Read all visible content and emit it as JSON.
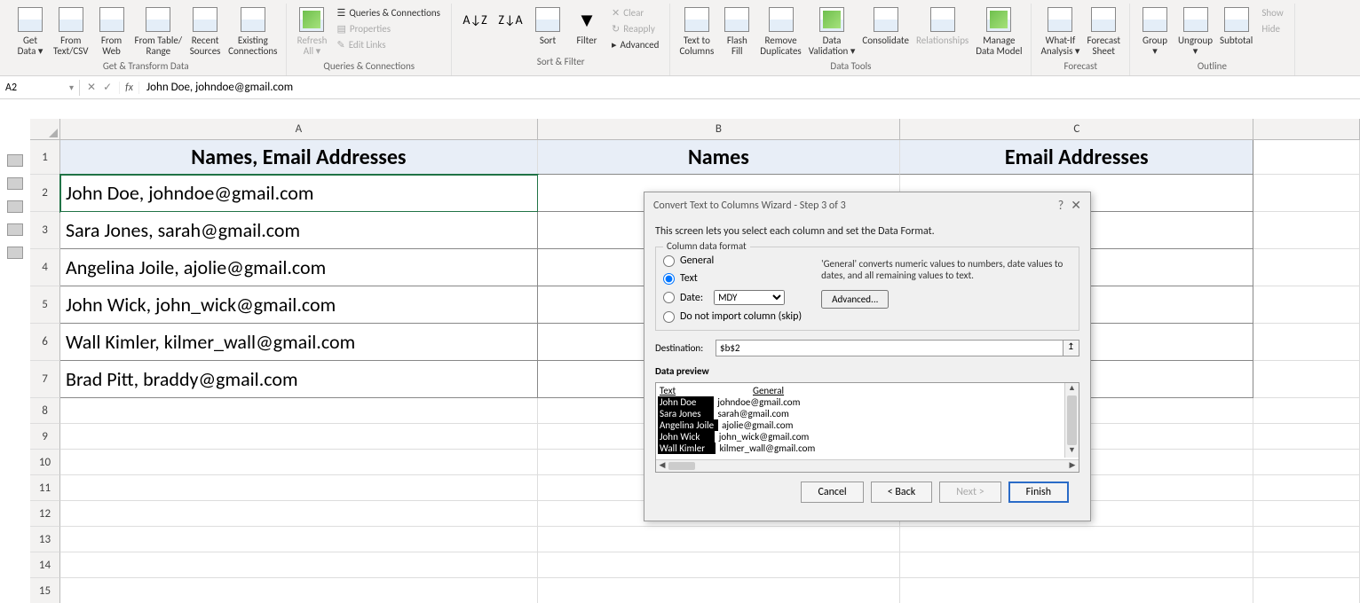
{
  "ribbon": {
    "groups": {
      "get_transform": {
        "label": "Get & Transform Data",
        "buttons": [
          "Get\nData ▾",
          "From\nText/CSV",
          "From\nWeb",
          "From Table/\nRange",
          "Recent\nSources",
          "Existing\nConnections"
        ]
      },
      "queries": {
        "label": "Queries & Connections",
        "buttons": [
          "Refresh\nAll ▾"
        ],
        "small": [
          "Queries & Connections",
          "Properties",
          "Edit Links"
        ]
      },
      "sort_filter": {
        "label": "Sort & Filter",
        "buttons": [
          "Sort",
          "Filter"
        ],
        "small": [
          "Clear",
          "Reapply",
          "Advanced"
        ]
      },
      "data_tools": {
        "label": "Data Tools",
        "buttons": [
          "Text to\nColumns",
          "Flash\nFill",
          "Remove\nDuplicates",
          "Data\nValidation ▾",
          "Consolidate",
          "Relationships",
          "Manage\nData Model"
        ]
      },
      "forecast": {
        "label": "Forecast",
        "buttons": [
          "What-If\nAnalysis ▾",
          "Forecast\nSheet"
        ]
      },
      "outline": {
        "label": "Outline",
        "buttons": [
          "Group\n▾",
          "Ungroup\n▾",
          "Subtotal"
        ],
        "small": [
          "Show",
          "Hide"
        ]
      }
    }
  },
  "name_box": "A2",
  "formula_value": "John Doe, johndoe@gmail.com",
  "columns": [
    "A",
    "B",
    "C",
    ""
  ],
  "row_numbers": [
    1,
    2,
    3,
    4,
    5,
    6,
    7,
    8,
    9,
    10,
    11,
    12,
    13,
    14,
    15
  ],
  "headers": [
    "Names, Email Addresses",
    "Names",
    "Email Addresses"
  ],
  "data_rows": [
    "John Doe, johndoe@gmail.com",
    "Sara Jones, sarah@gmail.com",
    "Angelina Joile, ajolie@gmail.com",
    "John Wick, john_wick@gmail.com",
    "Wall Kimler, kilmer_wall@gmail.com",
    "Brad Pitt, braddy@gmail.com"
  ],
  "dialog": {
    "title": "Convert Text to Columns Wizard - Step 3 of 3",
    "intro": "This screen lets you select each column and set the Data Format.",
    "fieldset_label": "Column data format",
    "radio_general": "General",
    "radio_text": "Text",
    "radio_date": "Date:",
    "date_value": "MDY",
    "radio_skip": "Do not import column (skip)",
    "general_note": "'General' converts numeric values to numbers, date values to dates, and all remaining values to text.",
    "advanced": "Advanced...",
    "destination_label": "Destination:",
    "destination_value": "$b$2",
    "preview_label": "Data preview",
    "preview_headers": [
      "Text",
      "General"
    ],
    "preview_rows": [
      [
        "John Doe",
        "johndoe@gmail.com"
      ],
      [
        "Sara Jones",
        "sarah@gmail.com"
      ],
      [
        "Angelina Joile",
        "ajolie@gmail.com"
      ],
      [
        "John Wick",
        "john_wick@gmail.com"
      ],
      [
        "Wall Kimler",
        "kilmer_wall@gmail.com"
      ]
    ],
    "btn_cancel": "Cancel",
    "btn_back": "< Back",
    "btn_next": "Next >",
    "btn_finish": "Finish"
  }
}
